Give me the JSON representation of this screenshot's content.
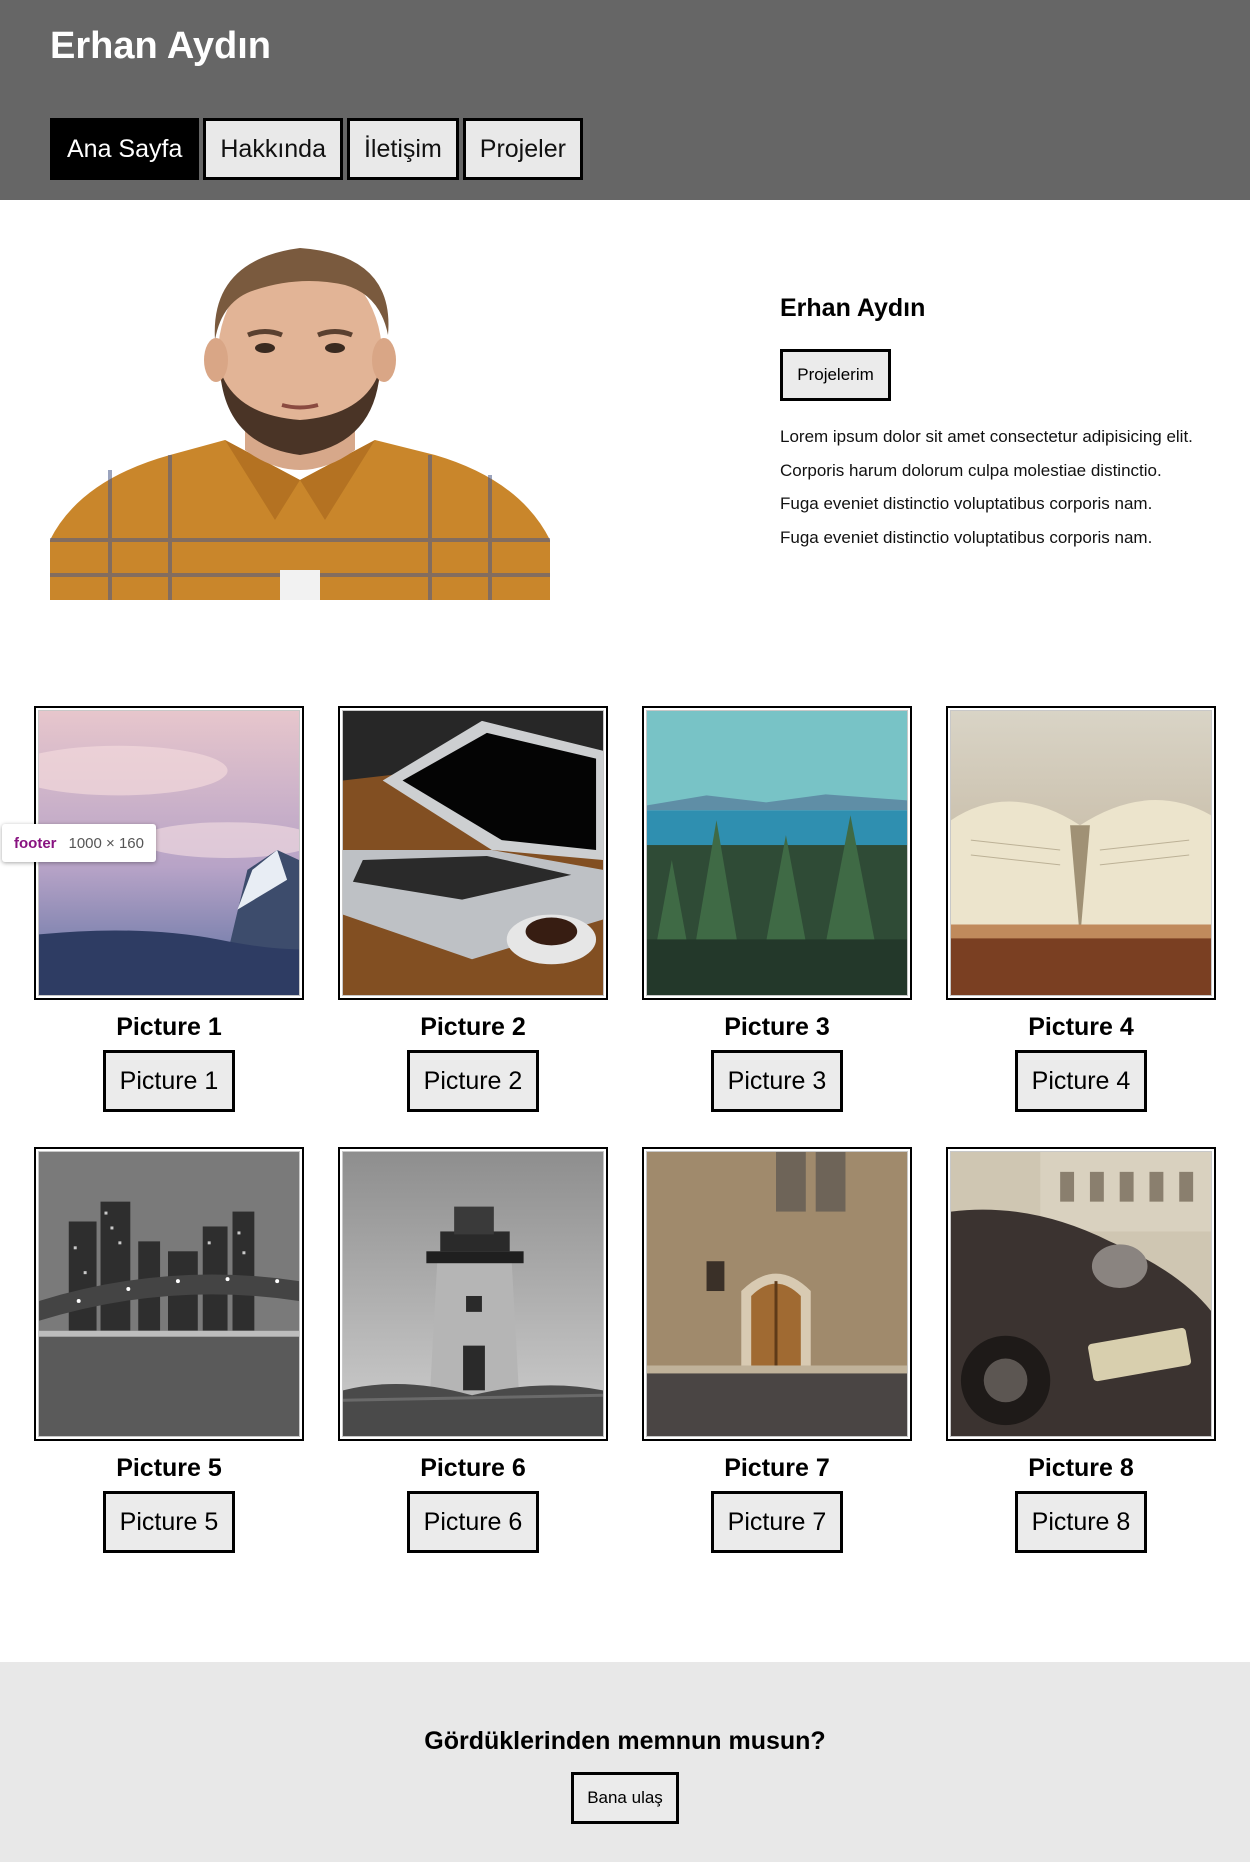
{
  "header": {
    "title": "Erhan Aydın",
    "nav": [
      "Ana Sayfa",
      "Hakkında",
      "İletişim",
      "Projeler"
    ],
    "active_nav": "Ana Sayfa"
  },
  "hero": {
    "name": "Erhan Aydın",
    "button": "Projelerim",
    "lines": [
      "Lorem ipsum dolor sit amet consectetur adipisicing elit.",
      "Corporis harum dolorum culpa molestiae distinctio.",
      "Fuga eveniet distinctio voluptatibus corporis nam.",
      "Fuga eveniet distinctio voluptatibus corporis nam."
    ]
  },
  "gallery": [
    {
      "title": "Picture 1",
      "button": "Picture 1"
    },
    {
      "title": "Picture 2",
      "button": "Picture 2"
    },
    {
      "title": "Picture 3",
      "button": "Picture 3"
    },
    {
      "title": "Picture 4",
      "button": "Picture 4"
    },
    {
      "title": "Picture 5",
      "button": "Picture 5"
    },
    {
      "title": "Picture 6",
      "button": "Picture 6"
    },
    {
      "title": "Picture 7",
      "button": "Picture 7"
    },
    {
      "title": "Picture 8",
      "button": "Picture 8"
    }
  ],
  "devtools_tooltip": {
    "tag": "footer",
    "size": "1000 × 160"
  },
  "footer": {
    "title": "Gördüklerinden memnun musun?",
    "button": "Bana ulaş"
  },
  "colors": {
    "header_bg": "#666666",
    "footer_bg": "#e8e8e8",
    "active_nav": "#000000"
  }
}
